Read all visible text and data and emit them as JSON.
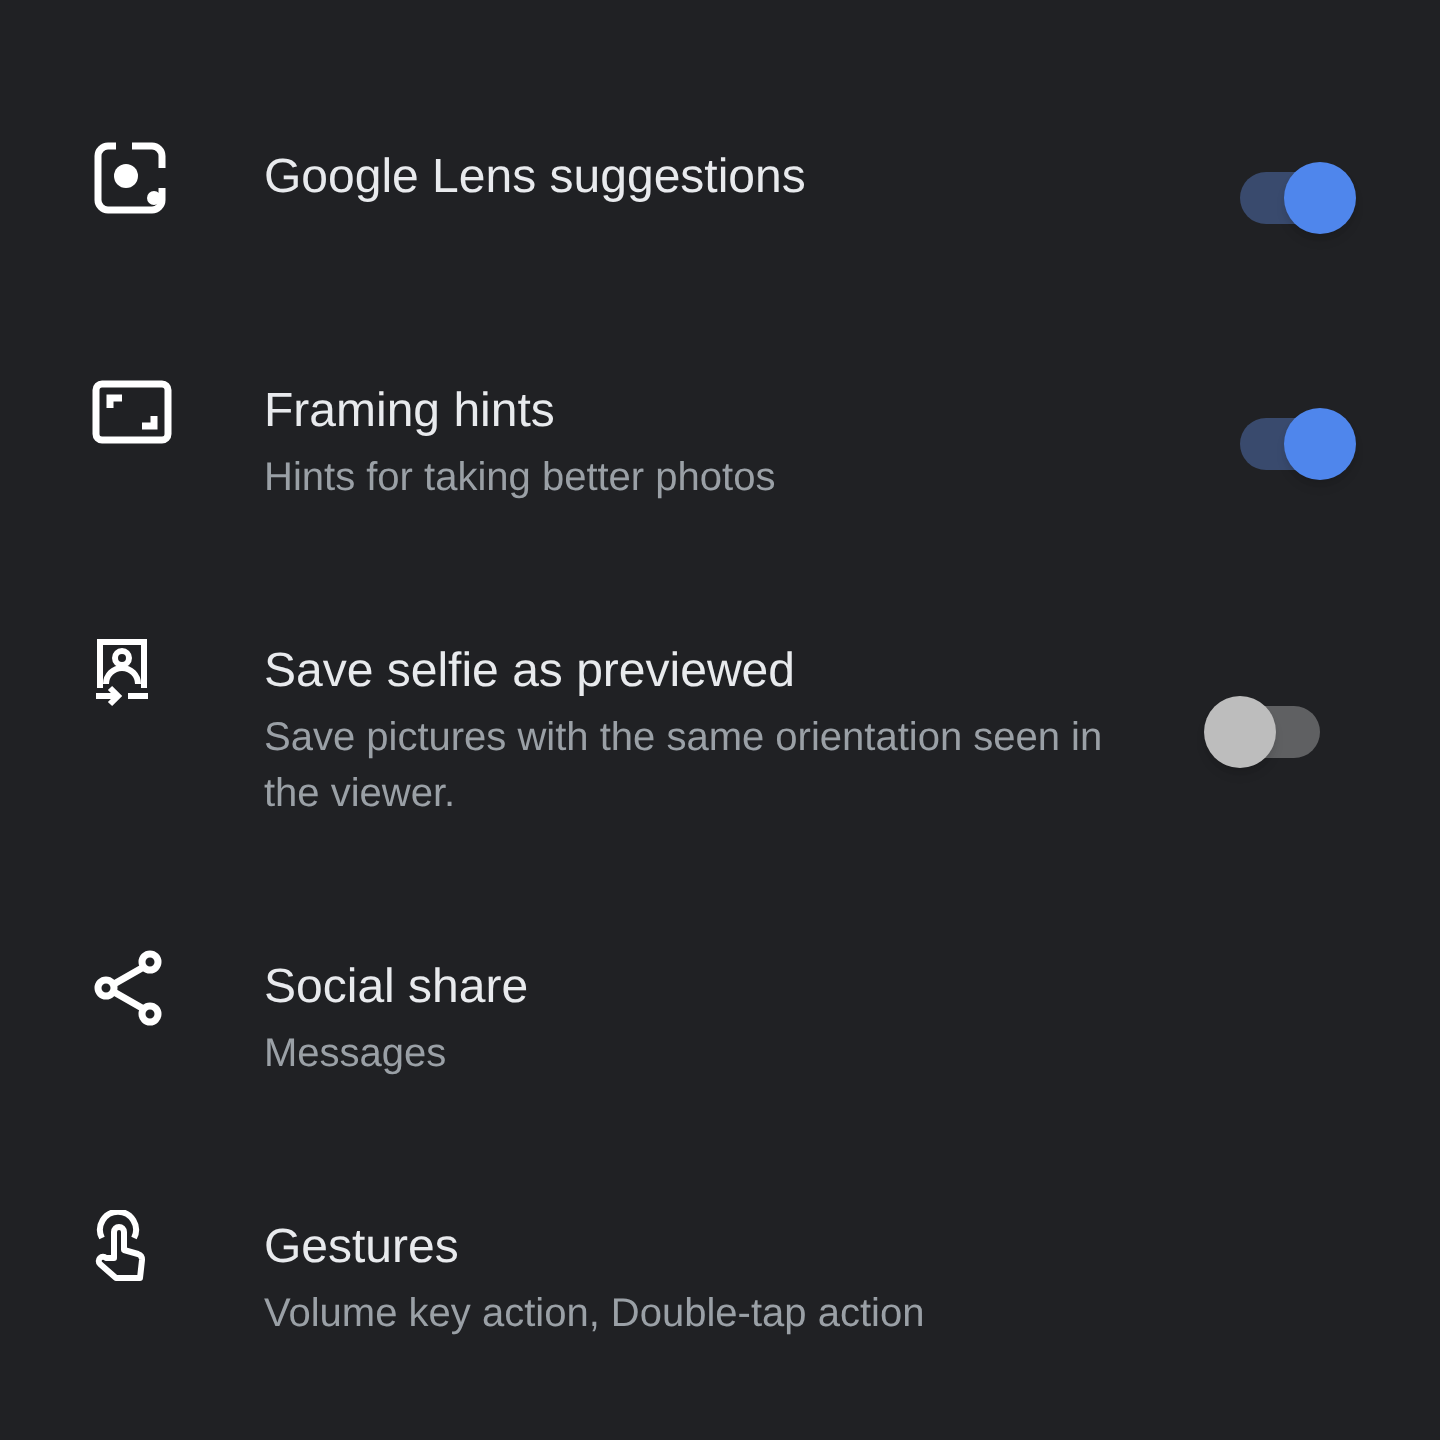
{
  "settings": [
    {
      "kind": "toggle",
      "title": "Google Lens suggestions",
      "on": true
    },
    {
      "kind": "toggle",
      "title": "Framing hints",
      "subtitle": "Hints for taking better photos",
      "on": true
    },
    {
      "kind": "toggle",
      "title": "Save selfie as previewed",
      "subtitle": "Save pictures with the same orientation seen in the viewer.",
      "on": false
    },
    {
      "kind": "link",
      "title": "Social share",
      "subtitle": "Messages"
    },
    {
      "kind": "link",
      "title": "Gestures",
      "subtitle": "Volume key action, Double-tap action"
    }
  ]
}
